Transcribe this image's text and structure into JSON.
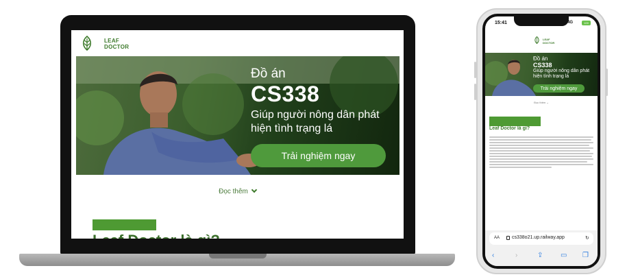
{
  "laptop": {
    "brand_line1": "LEAF",
    "brand_line2": "DOCTOR",
    "hero": {
      "subtitle": "Đồ án",
      "title": "CS338",
      "description": "Giúp người nông dân phát hiện tình trạng lá",
      "cta": "Trải nghiệm ngay"
    },
    "read_more": "Đọc thêm",
    "section_title_partial": "Leaf Doctor là gì?"
  },
  "phone": {
    "status": {
      "time": "15:41",
      "network": "4G",
      "battery": "100"
    },
    "brand_line1": "LEAF",
    "brand_line2": "DOCTOR",
    "hero": {
      "subtitle": "Đồ án",
      "title": "CS338",
      "description": "Giúp người nông dân phát hiện tình trạng lá",
      "cta": "Trải nghiệm ngay"
    },
    "read_more": "Đọc thêm",
    "section_title": "Leaf Doctor là gì?",
    "browser": {
      "text_size_label": "AA",
      "url": "cs338o21.up.railway.app"
    }
  },
  "colors": {
    "brand_green": "#3d7a2b",
    "button_green": "#4f9a3c",
    "bar_green": "#4e9a33"
  },
  "icons": {
    "logo": "leaf-icon",
    "chevron": "chevron-down-icon",
    "reload": "reload-icon",
    "back": "back-arrow-icon",
    "forward": "forward-arrow-icon",
    "share": "share-icon",
    "bookmarks": "book-icon",
    "tabs": "tabs-icon"
  }
}
